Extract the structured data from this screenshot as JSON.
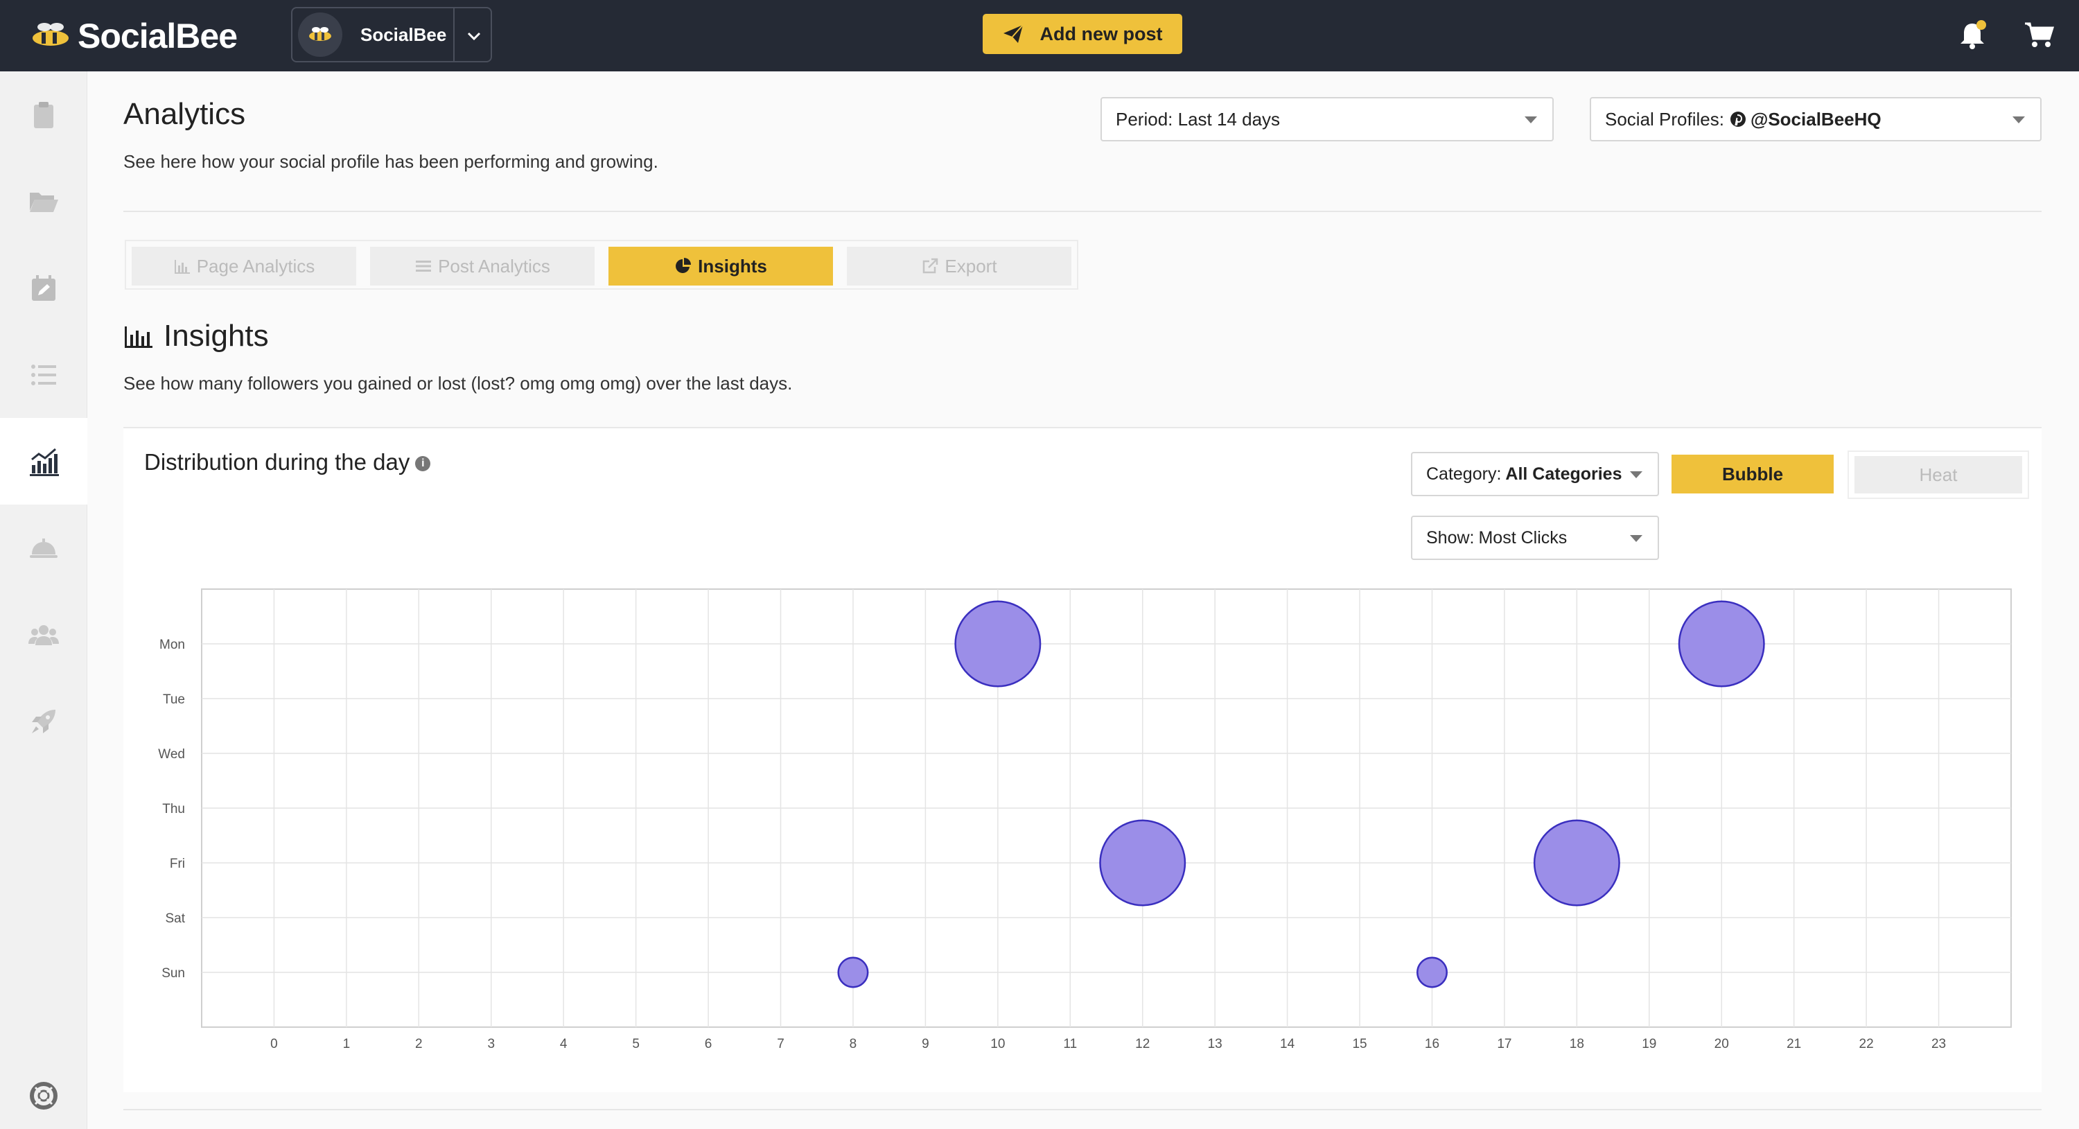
{
  "app": {
    "brand": "SocialBee",
    "account_name": "SocialBee",
    "add_post_label": "Add new post",
    "accent_color": "#efc13b",
    "topbar_color": "#252a35"
  },
  "sidebar": {
    "items": [
      {
        "icon": "clipboard-icon"
      },
      {
        "icon": "folder-open-icon"
      },
      {
        "icon": "calendar-edit-icon"
      },
      {
        "icon": "list-icon"
      },
      {
        "icon": "analytics-chart-icon",
        "active": true
      },
      {
        "icon": "concierge-bell-icon"
      },
      {
        "icon": "users-group-icon"
      },
      {
        "icon": "rocket-icon"
      },
      {
        "icon": "lifebuoy-icon"
      }
    ]
  },
  "header": {
    "title": "Analytics",
    "subtitle": "See here how your social profile has been performing and growing.",
    "period_label": "Period: Last 14 days",
    "profiles_prefix": "Social Profiles:",
    "profiles_value": "@SocialBeeHQ"
  },
  "tabs": [
    {
      "label": "Page Analytics",
      "icon": "bar-chart-icon"
    },
    {
      "label": "Post Analytics",
      "icon": "lines-icon"
    },
    {
      "label": "Insights",
      "icon": "pie-chart-icon",
      "active": true
    },
    {
      "label": "Export",
      "icon": "external-link-icon"
    }
  ],
  "insights": {
    "title": "Insights",
    "subtitle": "See how many followers you gained or lost (lost? omg omg omg) over the last days."
  },
  "card": {
    "title": "Distribution during the day",
    "category_prefix": "Category:",
    "category_value": "All Categories",
    "show_prefix": "Show:",
    "show_value": "Most Clicks",
    "bubble_label": "Bubble",
    "heat_label": "Heat"
  },
  "chart_data": {
    "type": "scatter",
    "variant": "bubble",
    "x_ticks": [
      "0",
      "1",
      "2",
      "3",
      "4",
      "5",
      "6",
      "7",
      "8",
      "9",
      "10",
      "11",
      "12",
      "13",
      "14",
      "15",
      "16",
      "17",
      "18",
      "19",
      "20",
      "21",
      "22",
      "23"
    ],
    "y_categories": [
      "Mon",
      "Tue",
      "Wed",
      "Thu",
      "Fri",
      "Sat",
      "Sun"
    ],
    "xlim": [
      -1,
      24
    ],
    "grid": true,
    "bubble_color": "#9b8ee8",
    "bubble_stroke": "#3a2fbf",
    "points": [
      {
        "x": 10,
        "y": "Mon",
        "size": 1.0
      },
      {
        "x": 20,
        "y": "Mon",
        "size": 1.0
      },
      {
        "x": 12,
        "y": "Fri",
        "size": 1.0
      },
      {
        "x": 18,
        "y": "Fri",
        "size": 1.0
      },
      {
        "x": 8,
        "y": "Sun",
        "size": 0.12
      },
      {
        "x": 16,
        "y": "Sun",
        "size": 0.12
      }
    ]
  }
}
